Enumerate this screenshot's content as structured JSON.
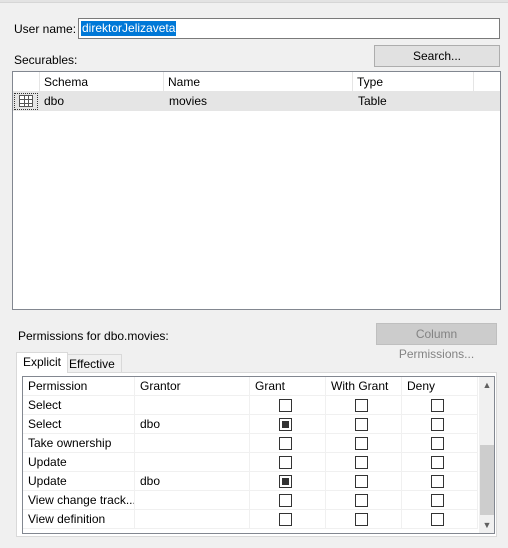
{
  "user_name_label": "User name:",
  "user_name_value": "direktorJelizaveta",
  "securables_label": "Securables:",
  "search_button": "Search...",
  "securables_grid": {
    "columns": [
      "Schema",
      "Name",
      "Type"
    ],
    "rows": [
      {
        "icon": "table-icon",
        "schema": "dbo",
        "name": "movies",
        "type": "Table"
      }
    ]
  },
  "permissions_label": "Permissions for dbo.movies:",
  "column_permissions_button": "Column Permissions...",
  "tabs": {
    "explicit": "Explicit",
    "effective": "Effective"
  },
  "permissions_grid": {
    "columns": [
      "Permission",
      "Grantor",
      "Grant",
      "With Grant",
      "Deny"
    ],
    "rows": [
      {
        "permission": "Select",
        "grantor": "",
        "grant": false,
        "with_grant": false,
        "deny": false
      },
      {
        "permission": "Select",
        "grantor": "dbo",
        "grant": true,
        "with_grant": false,
        "deny": false
      },
      {
        "permission": "Take ownership",
        "grantor": "",
        "grant": false,
        "with_grant": false,
        "deny": false
      },
      {
        "permission": "Update",
        "grantor": "",
        "grant": false,
        "with_grant": false,
        "deny": false
      },
      {
        "permission": "Update",
        "grantor": "dbo",
        "grant": true,
        "with_grant": false,
        "deny": false
      },
      {
        "permission": "View change track...",
        "grantor": "",
        "grant": false,
        "with_grant": false,
        "deny": false
      },
      {
        "permission": "View definition",
        "grantor": "",
        "grant": false,
        "with_grant": false,
        "deny": false
      }
    ]
  },
  "colors": {
    "selection": "#0078d7",
    "selected_row": "#e5e5e5",
    "background": "#f0f0f0"
  }
}
